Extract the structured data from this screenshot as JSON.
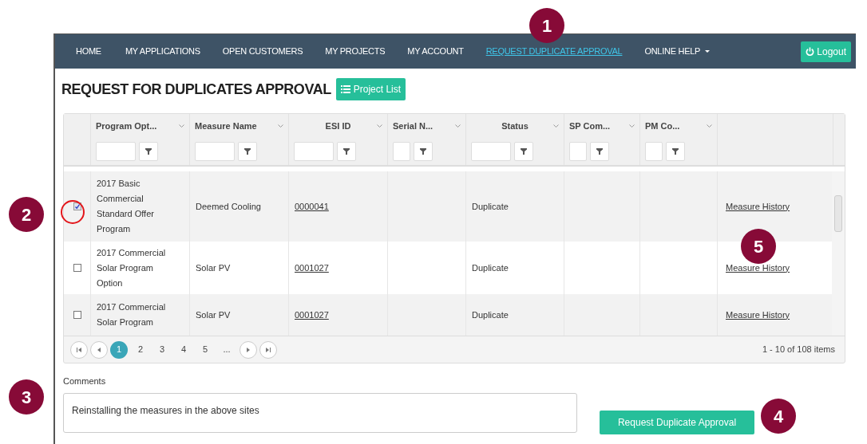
{
  "nav": {
    "items": [
      {
        "label": "HOME",
        "selected": false
      },
      {
        "label": "MY APPLICATIONS",
        "selected": false
      },
      {
        "label": "OPEN CUSTOMERS",
        "selected": false
      },
      {
        "label": "MY PROJECTS",
        "selected": false
      },
      {
        "label": "MY ACCOUNT",
        "selected": false
      },
      {
        "label": "REQUEST DUPLICATE APPROVAL",
        "selected": true
      },
      {
        "label": "ONLINE HELP",
        "selected": false,
        "dropdown": true
      }
    ],
    "logout": "Logout"
  },
  "page_title": "REQUEST FOR DUPLICATES APPROVAL",
  "project_list_button": "Project List",
  "table": {
    "columns": [
      "Program Opt...",
      "Measure Name",
      "ESI ID",
      "Serial N...",
      "Status",
      "SP Com...",
      "PM Co..."
    ],
    "rows": [
      {
        "checked": true,
        "program": "2017 Basic Commercial Standard Offer Program",
        "measure": "Deemed Cooling",
        "esi_id": "0000041",
        "status": "Duplicate",
        "action": "Measure History"
      },
      {
        "checked": false,
        "program": "2017 Commercial Solar Program Option",
        "measure": "Solar PV",
        "esi_id": "0001027",
        "status": "Duplicate",
        "action": "Measure History"
      },
      {
        "checked": false,
        "program": "2017 Commercial Solar Program",
        "measure": "Solar PV",
        "esi_id": "0001027",
        "status": "Duplicate",
        "action": "Measure History"
      }
    ],
    "pages": [
      {
        "label": "1",
        "selected": true
      },
      {
        "label": "2",
        "selected": false
      },
      {
        "label": "3",
        "selected": false
      },
      {
        "label": "4",
        "selected": false
      },
      {
        "label": "5",
        "selected": false
      },
      {
        "label": "...",
        "selected": false
      }
    ],
    "summary": "1 - 10 of 108 items"
  },
  "comments": {
    "label": "Comments",
    "value": "Reinstalling the measures in the above sites"
  },
  "submit_button": "Request Duplicate Approval",
  "callouts": [
    "1",
    "2",
    "3",
    "4",
    "5"
  ]
}
